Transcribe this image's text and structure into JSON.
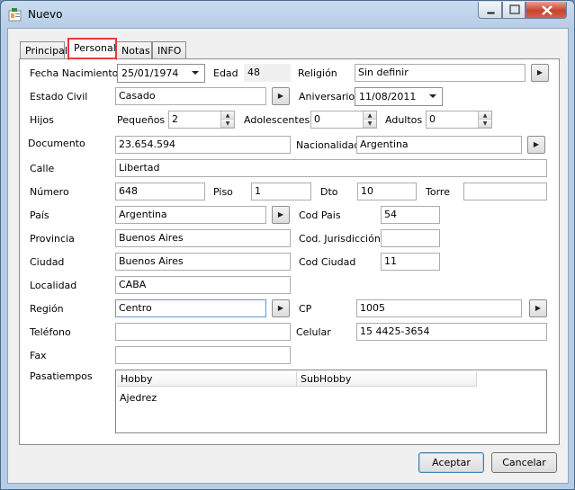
{
  "window": {
    "title": "Nuevo"
  },
  "tabs": [
    {
      "label": "Principal"
    },
    {
      "label": "Personal",
      "active": true
    },
    {
      "label": "Notas"
    },
    {
      "label": "INFO"
    }
  ],
  "personal": {
    "fecha_nacimiento": {
      "label": "Fecha Nacimiento",
      "value": "25/01/1974"
    },
    "edad": {
      "label": "Edad",
      "value": "48"
    },
    "religion": {
      "label": "Religión",
      "value": "Sin definir"
    },
    "estado_civil": {
      "label": "Estado Civil",
      "value": "Casado"
    },
    "aniversario": {
      "label": "Aniversario",
      "value": "11/08/2011"
    },
    "hijos": {
      "label": "Hijos"
    },
    "pequenos": {
      "label": "Pequeños",
      "value": "2"
    },
    "adolescentes": {
      "label": "Adolescentes",
      "value": "0"
    },
    "adultos": {
      "label": "Adultos",
      "value": "0"
    },
    "documento": {
      "label": "Documento",
      "value": "23.654.594"
    },
    "nacionalidad": {
      "label": "Nacionalidad",
      "value": "Argentina"
    },
    "calle": {
      "label": "Calle",
      "value": "Libertad"
    },
    "numero": {
      "label": "Número",
      "value": "648"
    },
    "piso": {
      "label": "Piso",
      "value": "1"
    },
    "dto": {
      "label": "Dto",
      "value": "10"
    },
    "torre": {
      "label": "Torre",
      "value": ""
    },
    "pais": {
      "label": "País",
      "value": "Argentina"
    },
    "cod_pais": {
      "label": "Cod Pais",
      "value": "54"
    },
    "provincia": {
      "label": "Provincia",
      "value": "Buenos Aires"
    },
    "cod_jurisdiccion": {
      "label": "Cod. Jurisdicción",
      "value": ""
    },
    "ciudad": {
      "label": "Ciudad",
      "value": "Buenos Aires"
    },
    "cod_ciudad": {
      "label": "Cod Ciudad",
      "value": "11"
    },
    "localidad": {
      "label": "Localidad",
      "value": "CABA"
    },
    "region": {
      "label": "Región",
      "value": "Centro"
    },
    "cp": {
      "label": "CP",
      "value": "1005"
    },
    "telefono": {
      "label": "Teléfono",
      "value": ""
    },
    "celular": {
      "label": "Celular",
      "value": "15 4425-3654"
    },
    "fax": {
      "label": "Fax",
      "value": ""
    },
    "pasatiempos": {
      "label": "Pasatiempos",
      "columns": [
        "Hobby",
        "SubHobby"
      ],
      "rows": [
        {
          "hobby": "Ajedrez",
          "subhobby": ""
        }
      ]
    }
  },
  "buttons": {
    "accept": "Aceptar",
    "cancel": "Cancelar"
  },
  "icons": {
    "lookup": "▶"
  }
}
